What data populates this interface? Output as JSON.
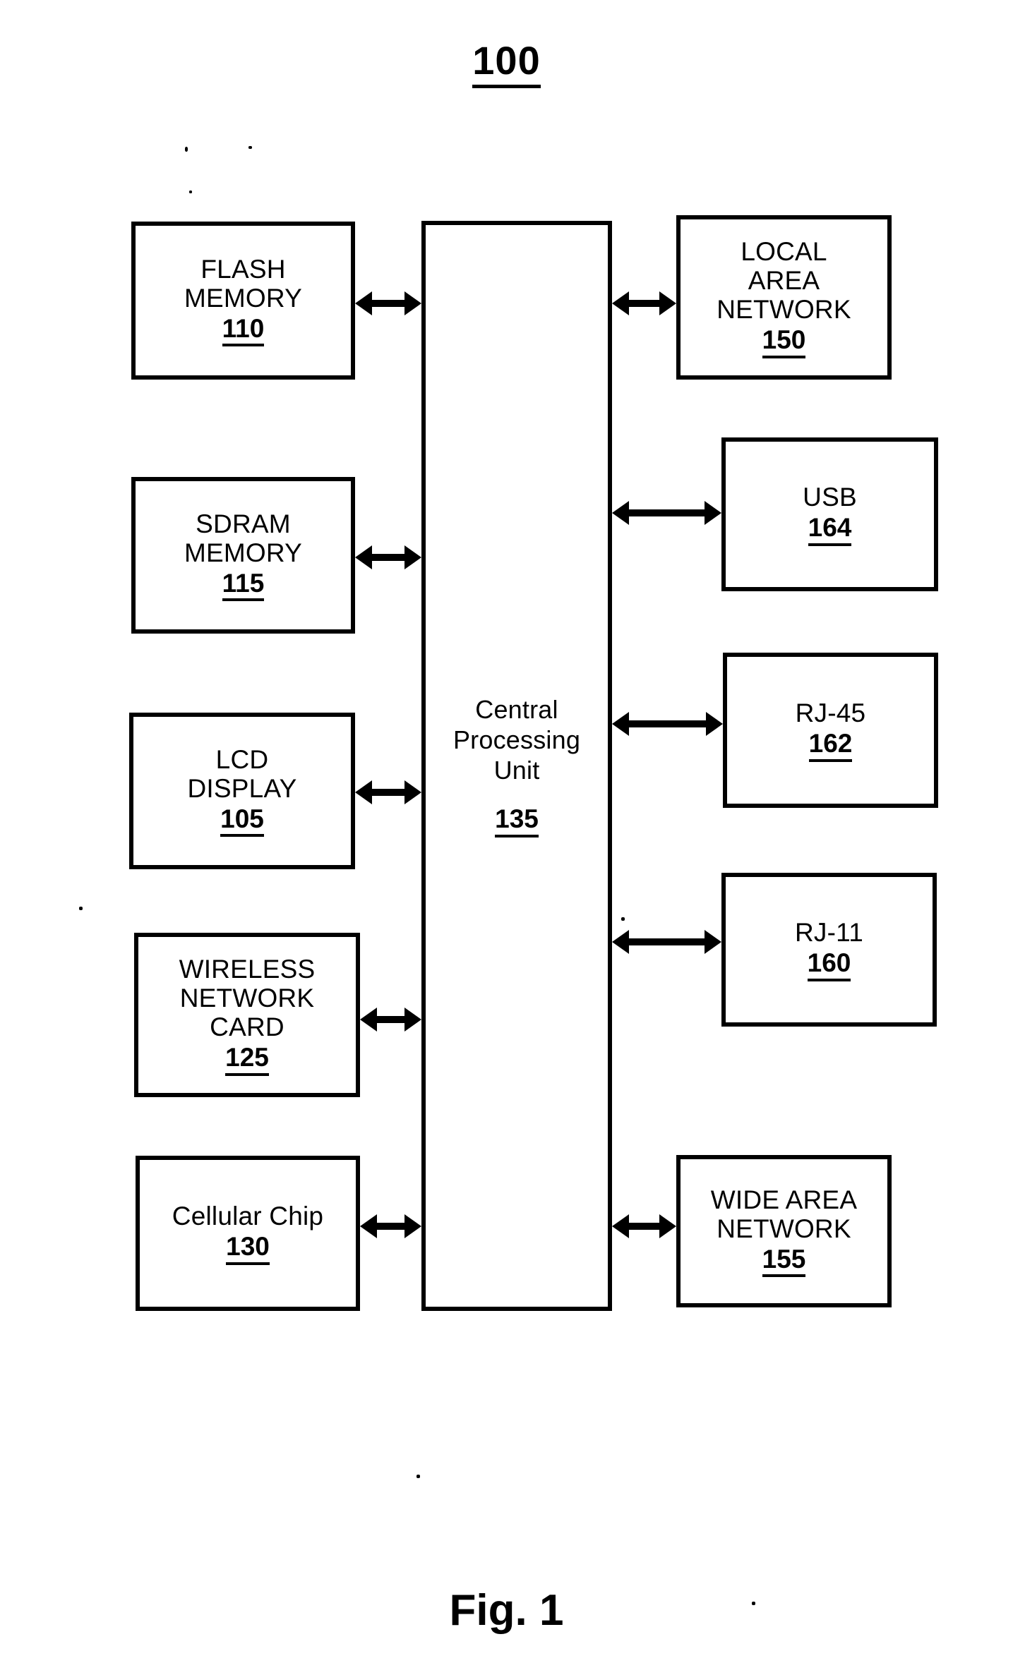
{
  "figure": {
    "number": "100",
    "caption": "Fig. 1"
  },
  "nodes": {
    "flash_memory": {
      "label": "FLASH\nMEMORY",
      "ref": "110"
    },
    "sdram_memory": {
      "label": "SDRAM\nMEMORY",
      "ref": "115"
    },
    "lcd_display": {
      "label": "LCD\nDISPLAY",
      "ref": "105"
    },
    "wireless_network_card": {
      "label": "WIRELESS\nNETWORK\nCARD",
      "ref": "125"
    },
    "cellular_chip": {
      "label": "Cellular Chip",
      "ref": "130"
    },
    "cpu": {
      "label": "Central\nProcessing\nUnit",
      "ref": "135"
    },
    "local_area_network": {
      "label": "LOCAL\nAREA\nNETWORK",
      "ref": "150"
    },
    "usb": {
      "label": "USB",
      "ref": "164"
    },
    "rj45": {
      "label": "RJ-45",
      "ref": "162"
    },
    "rj11": {
      "label": "RJ-11",
      "ref": "160"
    },
    "wide_area_network": {
      "label": "WIDE AREA\nNETWORK",
      "ref": "155"
    }
  },
  "connections": [
    {
      "name": "flash-memory-to-cpu",
      "type": "double-arrow"
    },
    {
      "name": "sdram-memory-to-cpu",
      "type": "double-arrow"
    },
    {
      "name": "lcd-display-to-cpu",
      "type": "double-arrow"
    },
    {
      "name": "wireless-network-card-to-cpu",
      "type": "double-arrow"
    },
    {
      "name": "cellular-chip-to-cpu",
      "type": "double-arrow"
    },
    {
      "name": "cpu-to-local-area-network",
      "type": "double-arrow"
    },
    {
      "name": "cpu-to-usb",
      "type": "double-arrow"
    },
    {
      "name": "cpu-to-rj45",
      "type": "double-arrow"
    },
    {
      "name": "cpu-to-rj11",
      "type": "double-arrow"
    },
    {
      "name": "cpu-to-wide-area-network",
      "type": "double-arrow"
    }
  ],
  "colors": {
    "stroke": "#000000",
    "background": "#ffffff"
  }
}
